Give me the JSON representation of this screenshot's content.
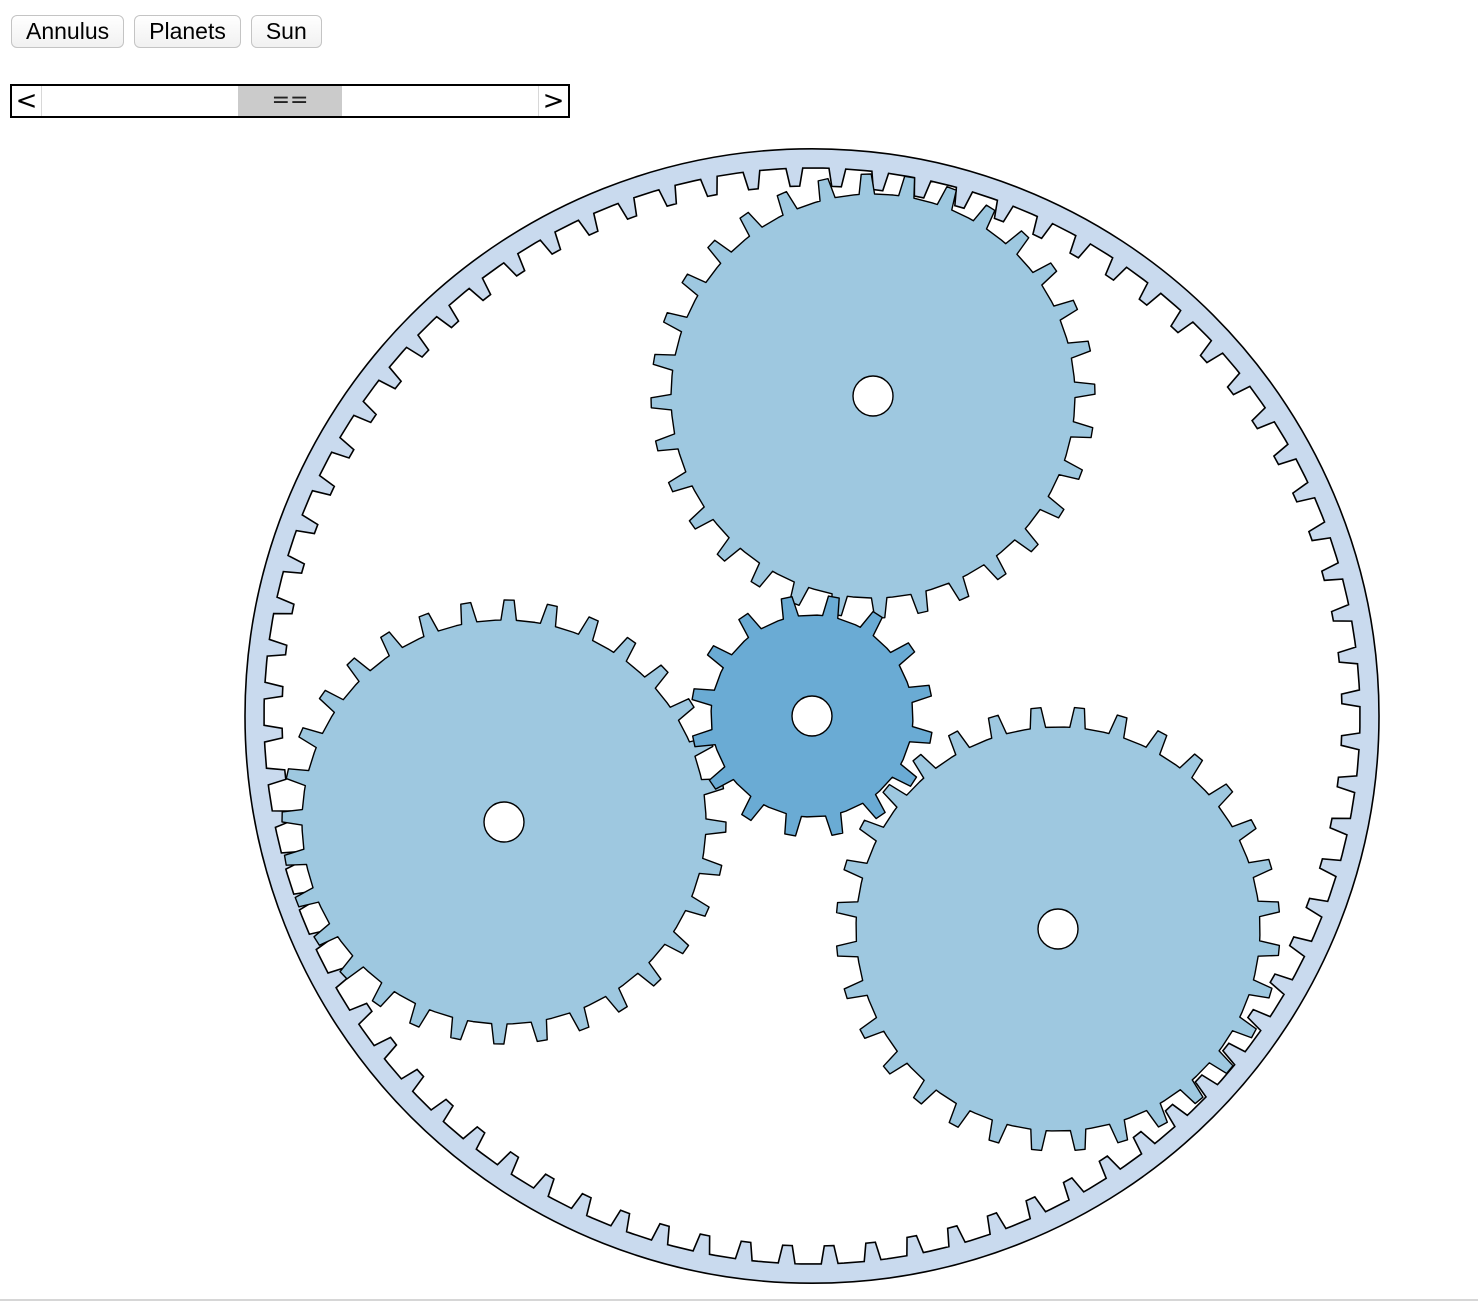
{
  "toolbar": {
    "buttons": [
      {
        "label": "Annulus"
      },
      {
        "label": "Planets"
      },
      {
        "label": "Sun"
      }
    ]
  },
  "slider": {
    "left_arrow": "<",
    "right_arrow": ">",
    "thumb_label": "=="
  },
  "colors": {
    "annulus": "#c9daee",
    "planet": "#9ec8e0",
    "sun": "#6aabd4",
    "stroke": "#000000",
    "hub": "#ffffff"
  },
  "gears": {
    "annulus_teeth": 80,
    "planet_teeth": 32,
    "sun_teeth": 16,
    "planet_count": 3
  }
}
